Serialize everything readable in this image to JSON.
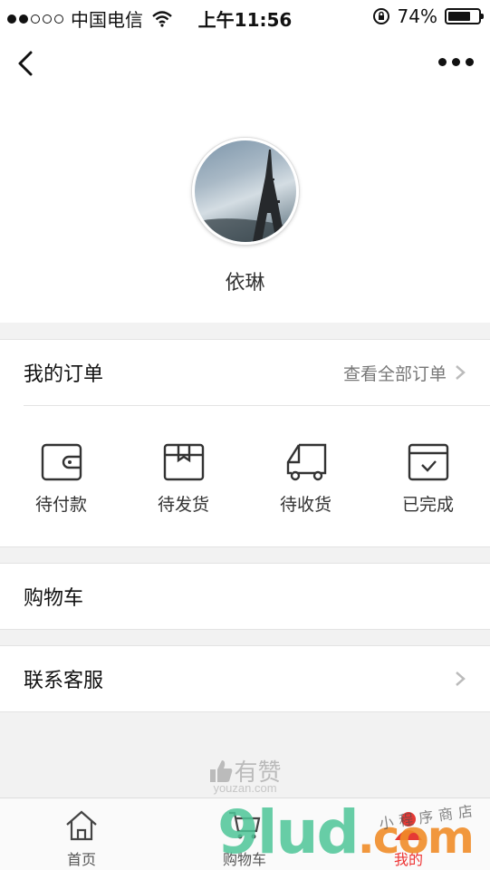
{
  "status_bar": {
    "carrier": "中国电信",
    "time": "上午11:56",
    "battery": "74%",
    "battery_level": 0.74
  },
  "nav": {
    "back_icon": "back-arrow-icon",
    "more_icon": "more-icon"
  },
  "profile": {
    "name": "依琳"
  },
  "orders": {
    "title": "我的订单",
    "view_all": "查看全部订单",
    "statuses": [
      {
        "label": "待付款",
        "icon": "wallet-icon"
      },
      {
        "label": "待发货",
        "icon": "package-icon"
      },
      {
        "label": "待收货",
        "icon": "truck-icon"
      },
      {
        "label": "已完成",
        "icon": "check-box-icon"
      }
    ]
  },
  "menu": {
    "cart": "购物车",
    "service": "联系客服"
  },
  "footer": {
    "brand": "有赞",
    "brand_sub": "youzan.com"
  },
  "tabbar": {
    "items": [
      {
        "label": "首页",
        "icon": "home-icon"
      },
      {
        "label": "购物车",
        "icon": "cart-icon"
      },
      {
        "label": "我的",
        "icon": "user-icon"
      }
    ],
    "active_color": "#e33333"
  },
  "watermark": {
    "text": "9lud",
    "suffix": ".com",
    "cn": "小程序商店"
  }
}
